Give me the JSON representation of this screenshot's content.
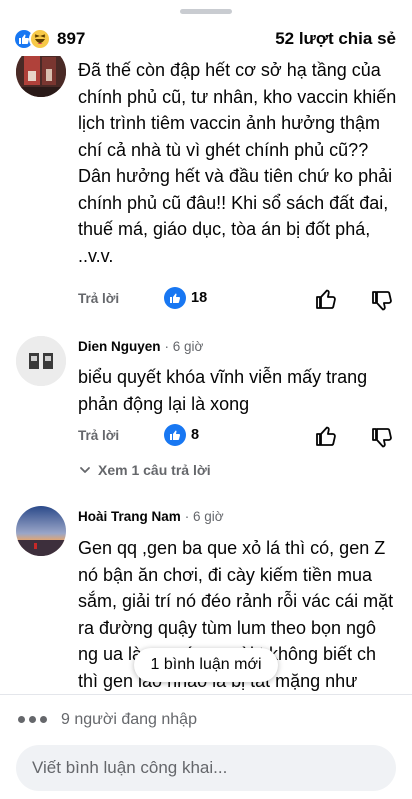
{
  "header": {
    "reaction_count": "897",
    "share_label": "52 lượt chia sẻ"
  },
  "comments": [
    {
      "author": "",
      "time": "",
      "text": "Đã thế còn đập hết cơ sở hạ tầng của chính phủ cũ,  tư nhân, kho vaccin khiến lịch trình tiêm vaccin ảnh hưởng thậm chí cả nhà tù vì ghét chính phủ cũ?? Dân hưởng hết và đầu tiên chứ ko phải chính phủ cũ đâu!! Khi sổ sách đất đai, thuế má, giáo dục, tòa án bị đốt phá, ..v.v.",
      "reply_label": "Trả lời",
      "likes": "18"
    },
    {
      "author": "Dien Nguyen",
      "time": "· 6 giờ",
      "text": "biểu quyết khóa vĩnh viễn mấy trang phản động lại là xong",
      "reply_label": "Trả lời",
      "likes": "8",
      "view_replies": "Xem 1 câu trả lời"
    },
    {
      "author": "Hoài Trang Nam",
      "time": "· 6 giờ",
      "text": "Gen qq ,gen ba que xỏ lá thì có, gen Z nó bận ăn chơi, đi cày kiếm tiền mua sắm, giải trí nó đéo rảnh rỗi vác cái mặt ra đường quậy tùm lum theo bọn ngô ng   ua lào, nước ngoài t không biết ch           thì gen láo nháo là bị tát mặng như thường, quy"
    }
  ],
  "new_comments_label": "1 bình luận mới",
  "typing_label": "9 người đang nhập",
  "composer_placeholder": "Viết bình luận công khai...",
  "colors": {
    "accent": "#1877f2",
    "secondary_text": "#65676b",
    "composer_bg": "#f0f2f5"
  },
  "icons": [
    "like-reaction-icon",
    "haha-reaction-icon",
    "thumb-up-icon",
    "thumb-down-icon",
    "chevron-down-icon",
    "typing-dots-icon"
  ]
}
